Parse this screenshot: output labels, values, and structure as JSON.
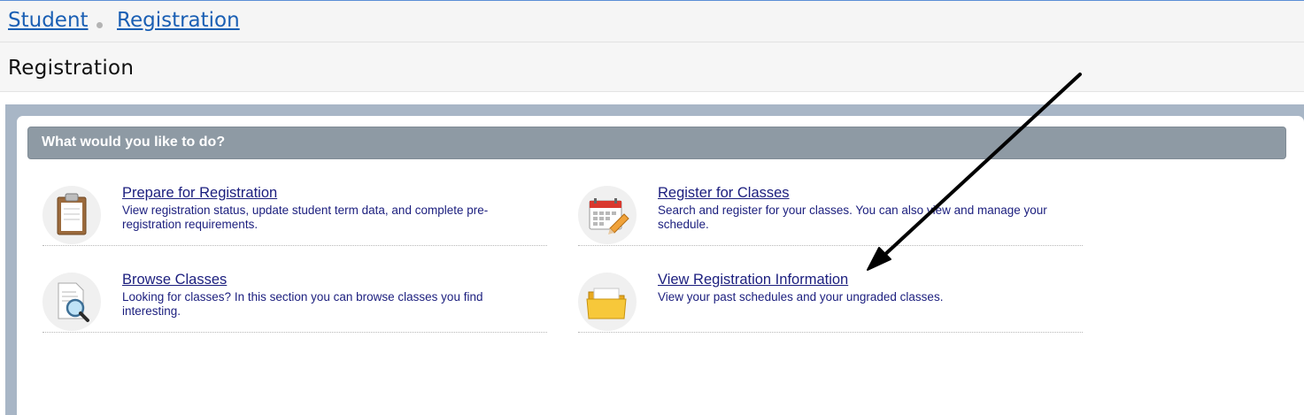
{
  "breadcrumb": {
    "items": [
      {
        "label": "Student"
      },
      {
        "label": "Registration"
      }
    ]
  },
  "page": {
    "title": "Registration"
  },
  "panel": {
    "header": "What would you like to do?",
    "options": [
      {
        "title": "Prepare for Registration",
        "description": "View registration status, update student term data, and complete pre-registration requirements.",
        "icon": "clipboard-icon"
      },
      {
        "title": "Register for Classes",
        "description": "Search and register for your classes. You can also view and manage your schedule.",
        "icon": "calendar-pencil-icon"
      },
      {
        "title": "Browse Classes",
        "description": "Looking for classes? In this section you can browse classes you find interesting.",
        "icon": "document-magnifier-icon"
      },
      {
        "title": "View Registration Information",
        "description": "View your past schedules and your ungraded classes.",
        "icon": "folder-icon"
      }
    ]
  },
  "colors": {
    "link": "#1a5fb4",
    "option_text": "#1b1e7e",
    "panel_header_bg": "#8e9aa4",
    "frame_bg": "#a8b6c6"
  }
}
